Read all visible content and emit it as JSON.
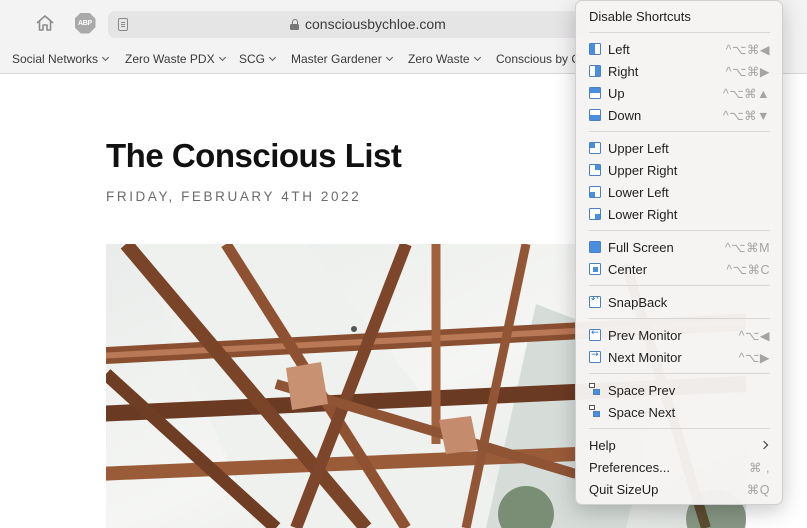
{
  "browser": {
    "url": "consciousbychloe.com",
    "adblock_label": "ABP",
    "bookmarks": [
      {
        "label": "Social Networks"
      },
      {
        "label": "Zero Waste PDX"
      },
      {
        "label": "SCG"
      },
      {
        "label": "Master Gardener"
      },
      {
        "label": "Zero Waste"
      },
      {
        "label": "Conscious by C"
      }
    ]
  },
  "article": {
    "title": "The Conscious List",
    "date": "FRIDAY, FEBRUARY 4TH 2022"
  },
  "menu": {
    "disable": {
      "label": "Disable Shortcuts"
    },
    "left": {
      "label": "Left",
      "shortcut": "^⌥⌘◀"
    },
    "right": {
      "label": "Right",
      "shortcut": "^⌥⌘▶"
    },
    "up": {
      "label": "Up",
      "shortcut": "^⌥⌘▲"
    },
    "down": {
      "label": "Down",
      "shortcut": "^⌥⌘▼"
    },
    "upper_left": {
      "label": "Upper Left"
    },
    "upper_right": {
      "label": "Upper Right"
    },
    "lower_left": {
      "label": "Lower Left"
    },
    "lower_right": {
      "label": "Lower Right"
    },
    "full_screen": {
      "label": "Full Screen",
      "shortcut": "^⌥⌘M"
    },
    "center": {
      "label": "Center",
      "shortcut": "^⌥⌘C"
    },
    "snapback": {
      "label": "SnapBack"
    },
    "prev_monitor": {
      "label": "Prev Monitor",
      "shortcut": "^⌥◀"
    },
    "next_monitor": {
      "label": "Next Monitor",
      "shortcut": "^⌥▶"
    },
    "space_prev": {
      "label": "Space Prev"
    },
    "space_next": {
      "label": "Space Next"
    },
    "help": {
      "label": "Help"
    },
    "preferences": {
      "label": "Preferences...",
      "shortcut": "⌘ ,"
    },
    "quit": {
      "label": "Quit SizeUp",
      "shortcut": "⌘Q"
    }
  },
  "colors": {
    "accent": "#4a8ee0",
    "menu_bg": "#f6f4f3",
    "toolbar_bg": "#f4f3f4"
  }
}
